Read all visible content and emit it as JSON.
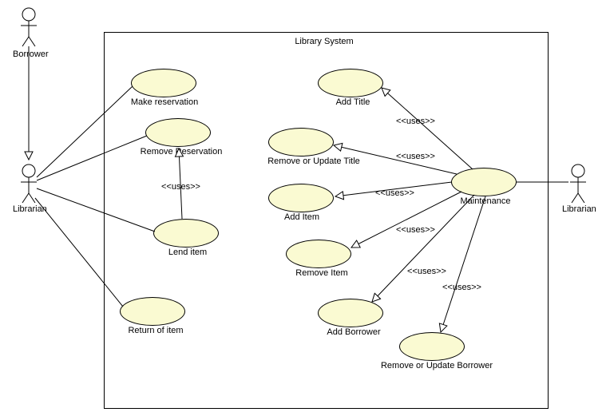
{
  "system": {
    "title": "Library System"
  },
  "actors": {
    "borrower": "Borrower",
    "librarian_left": "Librarian",
    "librarian_right": "Librarian"
  },
  "usecases": {
    "make_reservation": "Make reservation",
    "remove_reservation": "Remove Reservation",
    "lend_item": "Lend item",
    "return_item": "Return of item",
    "add_title": "Add Title",
    "remove_update_title": "Remove or Update Title",
    "add_item": "Add Item",
    "remove_item": "Remove Item",
    "add_borrower": "Add Borrower",
    "remove_update_borrower": "Remove or Update Borrower",
    "maintenance": "Maintenance"
  },
  "stereotypes": {
    "uses": "<<uses>>"
  },
  "chart_data": {
    "type": "uml-use-case",
    "system": "Library System",
    "actors": [
      "Borrower",
      "Librarian"
    ],
    "use_cases": [
      "Make reservation",
      "Remove Reservation",
      "Lend item",
      "Return of item",
      "Add Title",
      "Remove or Update Title",
      "Add Item",
      "Remove Item",
      "Add Borrower",
      "Remove or Update Borrower",
      "Maintenance"
    ],
    "relationships": [
      {
        "from": "Borrower",
        "to": "Librarian (left)",
        "type": "association"
      },
      {
        "from": "Librarian (left)",
        "to": "Make reservation",
        "type": "association"
      },
      {
        "from": "Librarian (left)",
        "to": "Remove Reservation",
        "type": "association"
      },
      {
        "from": "Librarian (left)",
        "to": "Lend item",
        "type": "association"
      },
      {
        "from": "Librarian (left)",
        "to": "Return of item",
        "type": "association"
      },
      {
        "from": "Lend item",
        "to": "Remove Reservation",
        "type": "uses"
      },
      {
        "from": "Librarian (right)",
        "to": "Maintenance",
        "type": "association"
      },
      {
        "from": "Maintenance",
        "to": "Add Title",
        "type": "uses"
      },
      {
        "from": "Maintenance",
        "to": "Remove or Update Title",
        "type": "uses"
      },
      {
        "from": "Maintenance",
        "to": "Add Item",
        "type": "uses"
      },
      {
        "from": "Maintenance",
        "to": "Remove Item",
        "type": "uses"
      },
      {
        "from": "Maintenance",
        "to": "Add Borrower",
        "type": "uses"
      },
      {
        "from": "Maintenance",
        "to": "Remove or Update Borrower",
        "type": "uses"
      }
    ]
  }
}
